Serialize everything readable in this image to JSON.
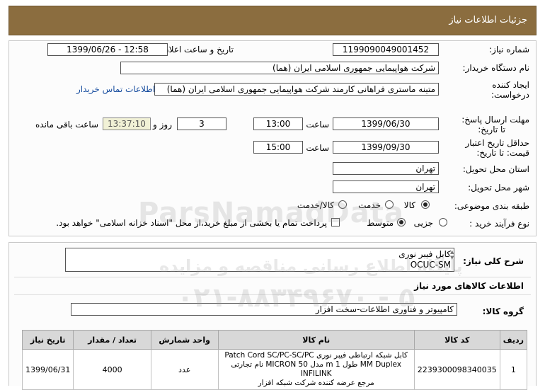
{
  "header": {
    "title": "جزئیات اطلاعات نیاز"
  },
  "fields": {
    "need_number_label": "شماره نیاز:",
    "need_number": "1199090049001452",
    "announce_datetime_label": "تاریخ و ساعت اعلان عمومی:",
    "announce_datetime": "1399/06/26 - 12:58",
    "buyer_org_label": "نام دستگاه خریدار:",
    "buyer_org": "شرکت هواپیمایی جمهوری اسلامی ایران (هما)",
    "requester_label_1": "ایجاد کننده",
    "requester_label_2": "درخواست:",
    "requester": "متینه ماستری فراهانی کارمند شرکت هواپیمایی جمهوری اسلامی ایران (هما)",
    "contact_link": "اطلاعات تماس خریدار",
    "reply_deadline_label_1": "مهلت ارسال پاسخ:",
    "reply_deadline_label_2": "تا تاریخ:",
    "reply_date": "1399/06/30",
    "time_label": "ساعت",
    "reply_time": "13:00",
    "days_count": "3",
    "days_and_label": "روز و",
    "remaining_time": "13:37:10",
    "remaining_label": "ساعت باقی مانده",
    "validity_label_1": "حداقل تاریخ اعتبار",
    "validity_label_2": "قیمت: تا تاریخ:",
    "validity_date": "1399/09/30",
    "validity_time": "15:00",
    "province_label": "استان محل تحویل:",
    "province": "تهران",
    "city_label": "شهر محل تحویل:",
    "city": "تهران",
    "category_label": "طبقه بندی موضوعی:",
    "category_options": [
      "کالا",
      "خدمت",
      "کالا/خدمت"
    ],
    "category_selected": "کالا",
    "purchase_type_label": "نوع فرآیند خرید :",
    "purchase_options": [
      "جزیی",
      "متوسط"
    ],
    "purchase_selected": "متوسط",
    "payment_note": "پرداخت تمام یا بخشی از مبلغ خرید،از محل \"اسناد خزانه اسلامی\" خواهد بود."
  },
  "summary": {
    "label": "شرح کلی نیاز:",
    "line1": "کابل فیبر نوری",
    "line2": "OCUC-SM"
  },
  "goods": {
    "section_title": "اطلاعات کالاهای مورد نیاز",
    "group_label": "گروه کالا:",
    "group_value": "کامپیوتر و فناوری اطلاعات-سخت افزار"
  },
  "table": {
    "headers": [
      "ردیف",
      "کد کالا",
      "نام کالا",
      "واحد شمارش",
      "تعداد / مقدار",
      "تاریخ نیاز"
    ],
    "rows": [
      {
        "row": "1",
        "code": "2239300098340035",
        "name_line1": "کابل شبکه ارتباطی فیبر نوری Patch Cord SC/PC-SC/PC",
        "name_line2": "MM Duplex طول 1 m مدل MICRON 50 نام تجارتی INFILINK",
        "name_line3": "مرجع عرضه کننده شرکت شبکه افزار",
        "unit": "عدد",
        "qty": "4000",
        "date": "1399/06/31"
      }
    ]
  },
  "watermark": {
    "brand": "ParsNamadData",
    "line1": "پایگاه اطلاع رسانی مناقصه و مزایده",
    "phone": "۰۲۱-۸۸۳۴۹۶۷۰ - ۵"
  },
  "colors": {
    "header_bg": "#8b6d3f",
    "link": "#1a4fa0",
    "timer_bg": "#f1f1d6"
  }
}
